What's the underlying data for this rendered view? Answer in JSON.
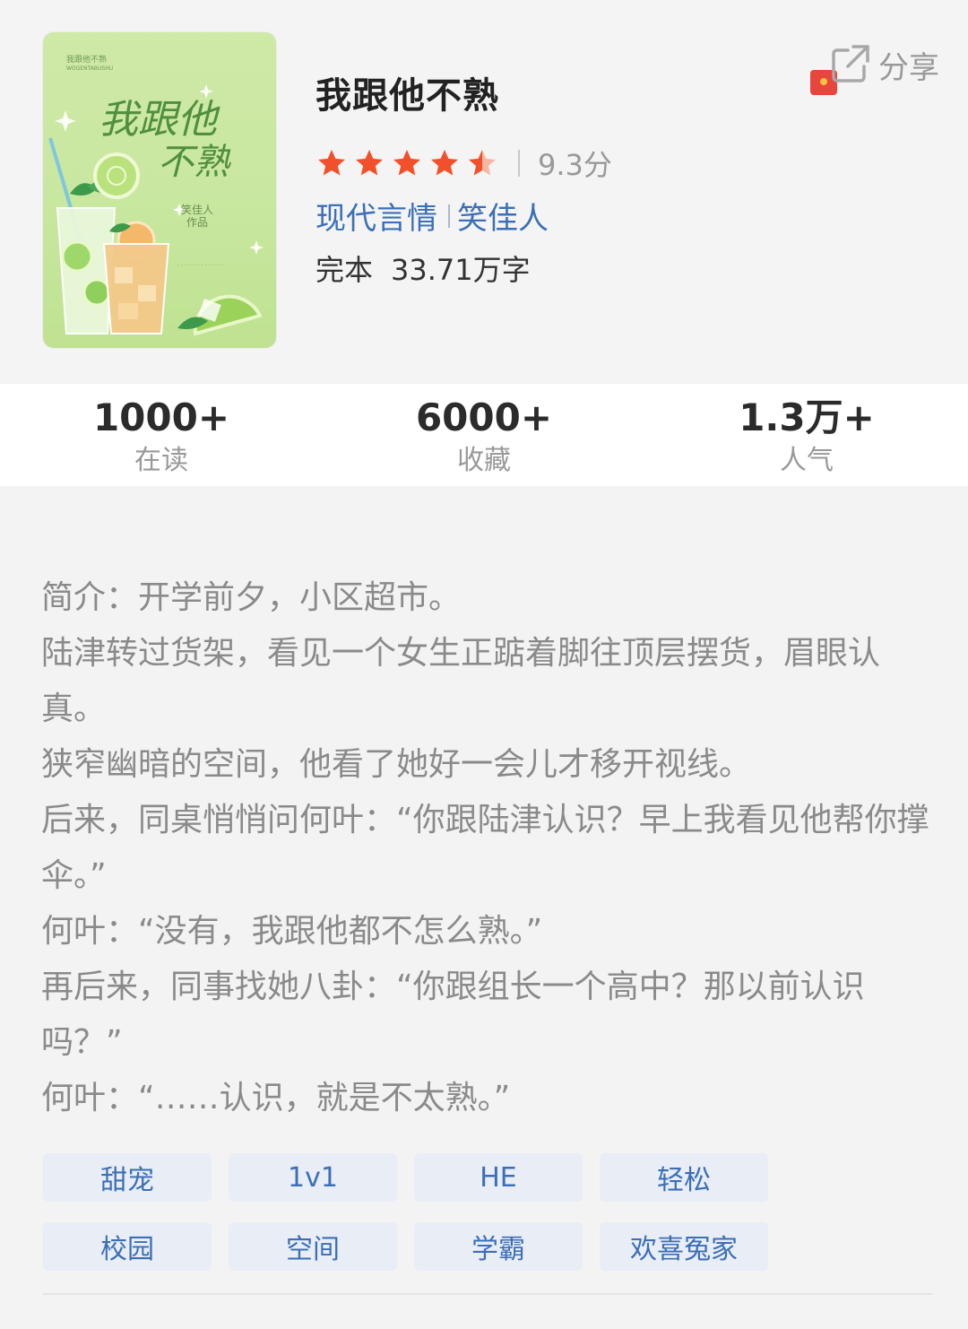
{
  "book": {
    "title": "我跟他不熟",
    "rating_score": "9.3分",
    "rating_stars": 4.5,
    "category": "现代言情",
    "author": "笑佳人",
    "status": "完本",
    "word_count": "33.71万字"
  },
  "cover": {
    "small_title": "我跟他不熟",
    "pinyin": "WOGENTABUSHU",
    "calligraphy_line1": "我跟他",
    "calligraphy_line2": "不熟",
    "author_line1": "笑佳人",
    "author_line2": "作品"
  },
  "share": {
    "label": "分享"
  },
  "stats": [
    {
      "value": "1000+",
      "label": "在读"
    },
    {
      "value": "6000+",
      "label": "收藏"
    },
    {
      "value": "1.3万+",
      "label": "人气"
    }
  ],
  "synopsis": [
    "简介：开学前夕，小区超市。",
    "陆津转过货架，看见一个女生正踮着脚往顶层摆货，眉眼认真。",
    "狭窄幽暗的空间，他看了她好一会儿才移开视线。",
    "后来，同桌悄悄问何叶：“你跟陆津认识？早上我看见他帮你撑伞。”",
    "何叶：“没有，我跟他都不怎么熟。”",
    "再后来，同事找她八卦：“你跟组长一个高中？那以前认识吗？”",
    "何叶：“……认识，就是不太熟。”"
  ],
  "tags": [
    "甜宠",
    "1v1",
    "HE",
    "轻松",
    "校园",
    "空间",
    "学霸",
    "欢喜冤家"
  ],
  "colors": {
    "accent_blue": "#3c6fb5",
    "star": "#f2502a",
    "cover_bg": "#cbe8a3"
  }
}
